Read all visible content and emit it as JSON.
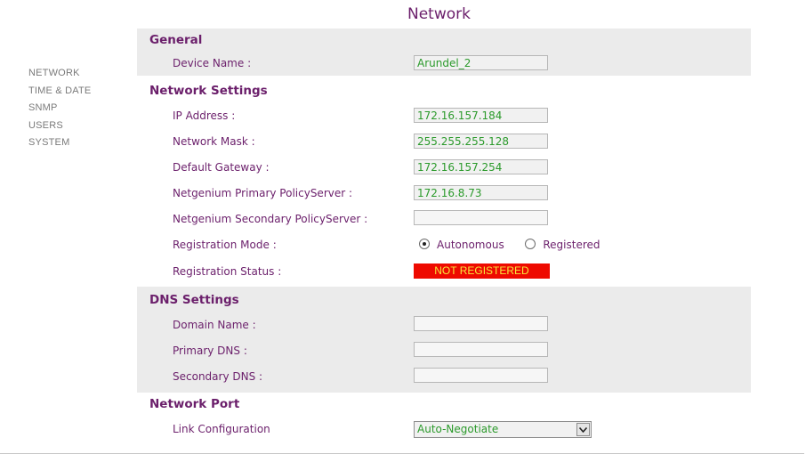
{
  "page_title": "Network",
  "nav": {
    "items": [
      {
        "label": "NETWORK"
      },
      {
        "label": "TIME & DATE"
      },
      {
        "label": "SNMP"
      },
      {
        "label": "USERS"
      },
      {
        "label": "SYSTEM"
      }
    ]
  },
  "general": {
    "header": "General",
    "device_name_label": "Device Name :",
    "device_name_value": "Arundel_2"
  },
  "network_settings": {
    "header": "Network Settings",
    "ip_label": "IP Address :",
    "ip_value": "172.16.157.184",
    "mask_label": "Network Mask :",
    "mask_value": "255.255.255.128",
    "gateway_label": "Default Gateway :",
    "gateway_value": "172.16.157.254",
    "primary_policy_label": "Netgenium Primary PolicyServer :",
    "primary_policy_value": "172.16.8.73",
    "secondary_policy_label": "Netgenium Secondary PolicyServer :",
    "secondary_policy_value": "",
    "reg_mode_label": "Registration Mode :",
    "reg_mode_options": [
      "Autonomous",
      "Registered"
    ],
    "reg_mode_selected": "Autonomous",
    "reg_status_label": "Registration Status :",
    "reg_status_value": "NOT REGISTERED"
  },
  "dns_settings": {
    "header": "DNS Settings",
    "domain_label": "Domain Name :",
    "domain_value": "",
    "primary_dns_label": "Primary DNS :",
    "primary_dns_value": "",
    "secondary_dns_label": "Secondary DNS :",
    "secondary_dns_value": ""
  },
  "network_port": {
    "header": "Network Port",
    "link_label": "Link Configuration",
    "link_value": "Auto-Negotiate"
  },
  "colors": {
    "label": "#6b1f6b",
    "value": "#2b9a2b",
    "section_bg": "#ebebeb",
    "status_bg": "#ee0a00",
    "status_text": "#f6e63b",
    "nav_text": "#7a7a7a"
  },
  "icons": {
    "select_arrow": "chevron-down-icon"
  }
}
